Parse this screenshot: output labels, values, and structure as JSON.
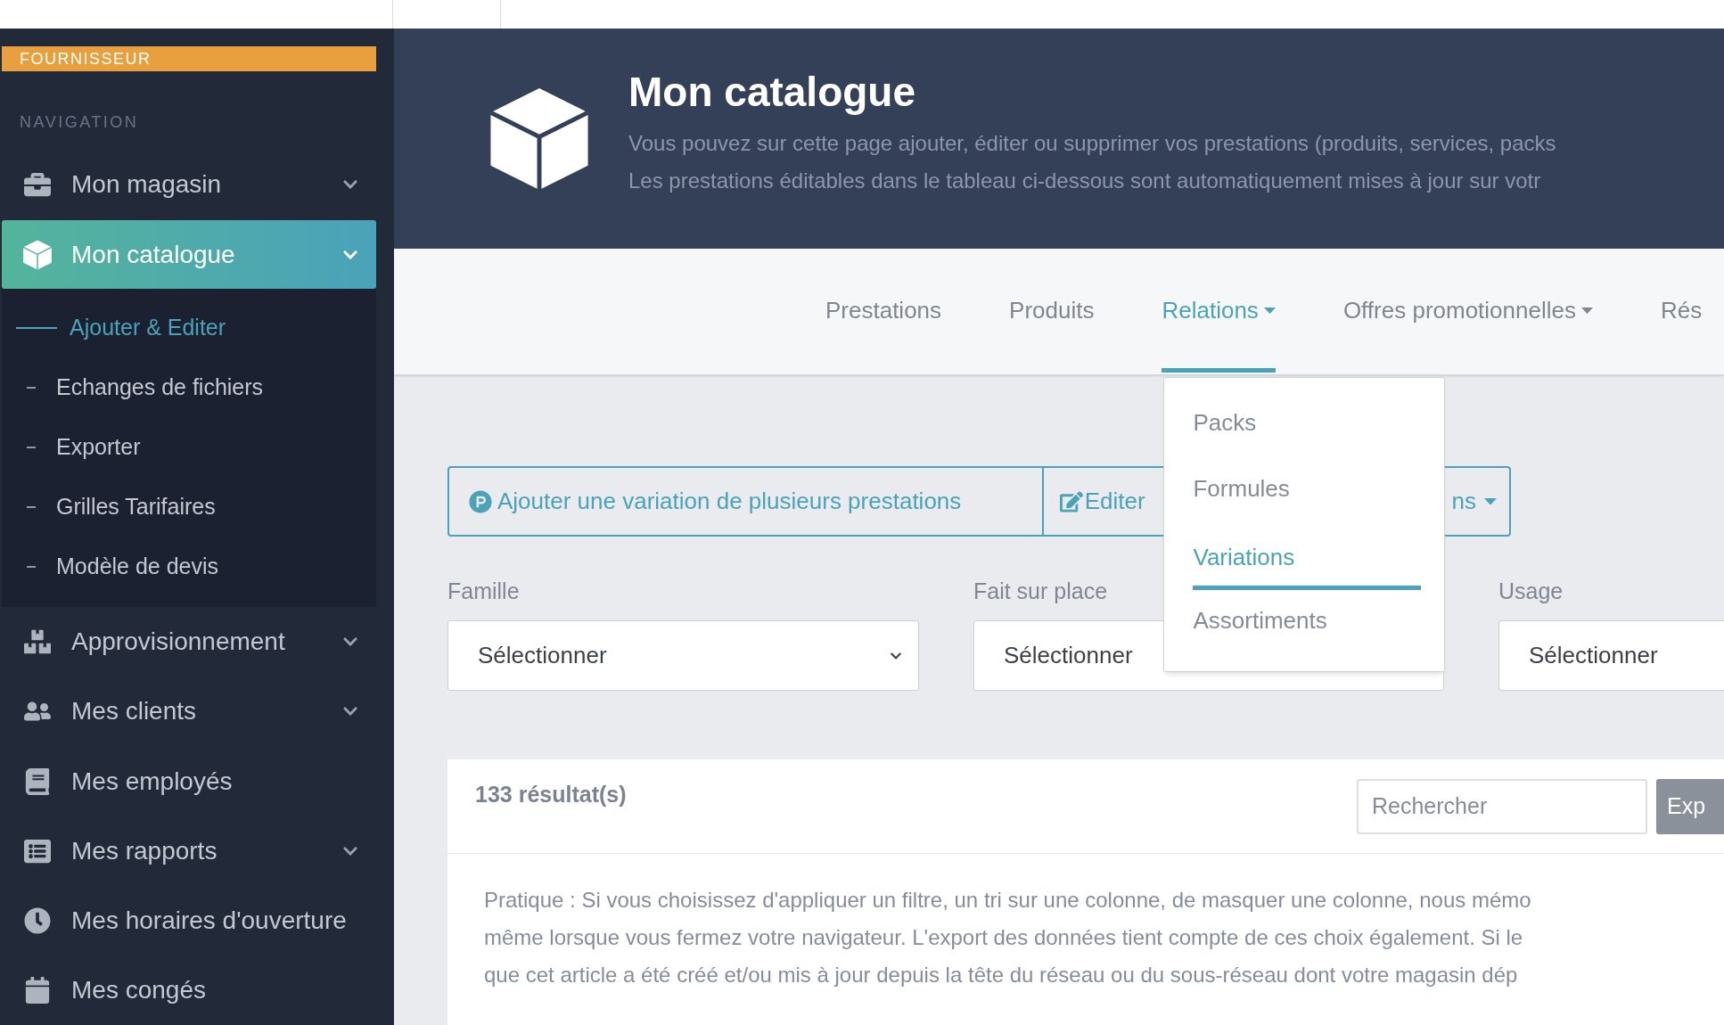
{
  "sidebar": {
    "role_badge": "FOURNISSEUR",
    "section_title": "NAVIGATION",
    "items": [
      {
        "label": "Mon magasin",
        "selected": false,
        "has_submenu": true
      },
      {
        "label": "Mon catalogue",
        "selected": true,
        "has_submenu": true,
        "children": [
          {
            "label": "Ajouter & Editer",
            "selected": true
          },
          {
            "label": "Echanges de fichiers",
            "selected": false
          },
          {
            "label": "Exporter",
            "selected": false
          },
          {
            "label": "Grilles Tarifaires",
            "selected": false
          },
          {
            "label": "Modèle de devis",
            "selected": false
          }
        ]
      },
      {
        "label": "Approvisionnement",
        "selected": false,
        "has_submenu": true
      },
      {
        "label": "Mes clients",
        "selected": false,
        "has_submenu": true
      },
      {
        "label": "Mes employés",
        "selected": false,
        "has_submenu": false
      },
      {
        "label": "Mes rapports",
        "selected": false,
        "has_submenu": true
      },
      {
        "label": "Mes horaires d'ouverture",
        "selected": false,
        "has_submenu": false
      },
      {
        "label": "Mes congés",
        "selected": false,
        "has_submenu": false
      }
    ]
  },
  "header": {
    "title": "Mon catalogue",
    "description": [
      "Vous pouvez sur cette page ajouter, éditer ou supprimer vos prestations (produits, services, packs",
      "Les prestations éditables dans le tableau ci-dessous sont automatiquement mises à jour sur votr"
    ]
  },
  "tabs": [
    {
      "label": "Prestations",
      "selected": false,
      "has_menu": false
    },
    {
      "label": "Produits",
      "selected": false,
      "has_menu": false
    },
    {
      "label": "Relations",
      "selected": true,
      "has_menu": true,
      "menu": [
        {
          "label": "Packs",
          "selected": false
        },
        {
          "label": "Formules",
          "selected": false
        },
        {
          "label": "Variations",
          "selected": true
        },
        {
          "label": "Assortiments",
          "selected": false
        }
      ]
    },
    {
      "label": "Offres promotionnelles",
      "selected": false,
      "has_menu": true
    },
    {
      "label": "Rés",
      "selected": false,
      "has_menu": false
    }
  ],
  "actions": {
    "add_button": "Ajouter une variation de plusieurs prestations",
    "edit_button": {
      "label_start": "Editer",
      "label_end": "ns"
    }
  },
  "filters": [
    {
      "label": "Famille",
      "value": "Sélectionner"
    },
    {
      "label": "Fait sur place",
      "value": "Sélectionner"
    },
    {
      "label": "Usage",
      "value": "Sélectionner"
    }
  ],
  "results": {
    "count": "133 résultat(s)",
    "search": {
      "placeholder": "Rechercher"
    },
    "export_button": "Exp",
    "notice": [
      "Pratique : Si vous choisissez d'appliquer un filtre, un tri sur une colonne, de masquer une colonne, nous mémo",
      "même lorsque vous fermez votre navigateur. L'export des données tient compte de ces choix également.  Si le",
      "que cet article a été créé et/ou mis à jour depuis la tête du réseau ou du sous-réseau dont votre magasin dép"
    ]
  }
}
